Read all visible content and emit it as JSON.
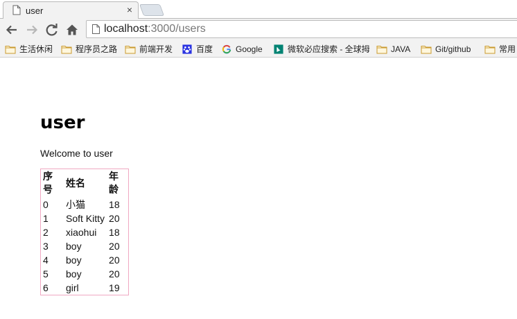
{
  "tab": {
    "title": "user",
    "close_glyph": "×",
    "icon": "page-icon"
  },
  "toolbar": {
    "icons": [
      "back-icon",
      "forward-icon",
      "reload-icon",
      "home-icon"
    ],
    "url_host": "localhost",
    "url_path": ":3000/users"
  },
  "bookmarks": [
    {
      "label": "生活休闲",
      "icon": "folder-icon"
    },
    {
      "label": "程序员之路",
      "icon": "folder-icon"
    },
    {
      "label": "前端开发",
      "icon": "folder-icon"
    },
    {
      "label": "百度",
      "icon": "baidu-icon"
    },
    {
      "label": "Google",
      "icon": "google-icon"
    },
    {
      "label": "微软必应搜索 - 全球拇",
      "icon": "bing-icon"
    },
    {
      "label": "JAVA",
      "icon": "folder-icon"
    },
    {
      "label": "Git/github",
      "icon": "folder-icon"
    },
    {
      "label": "常用",
      "icon": "folder-icon"
    }
  ],
  "page": {
    "heading": "user",
    "welcome": "Welcome to user",
    "table": {
      "headers": [
        "序号",
        "姓名",
        "年龄"
      ],
      "rows": [
        [
          "0",
          "小猫",
          "18"
        ],
        [
          "1",
          "Soft Kitty",
          "20"
        ],
        [
          "2",
          "xiaohui",
          "18"
        ],
        [
          "3",
          "boy",
          "20"
        ],
        [
          "4",
          "boy",
          "20"
        ],
        [
          "5",
          "boy",
          "20"
        ],
        [
          "6",
          "girl",
          "19"
        ]
      ]
    }
  },
  "colors": {
    "chrome_bg": "#f2f2f2",
    "folder": "#e8b84a",
    "table_border": "#f0a8c2",
    "baidu": "#2932e1",
    "bing": "#008373"
  }
}
